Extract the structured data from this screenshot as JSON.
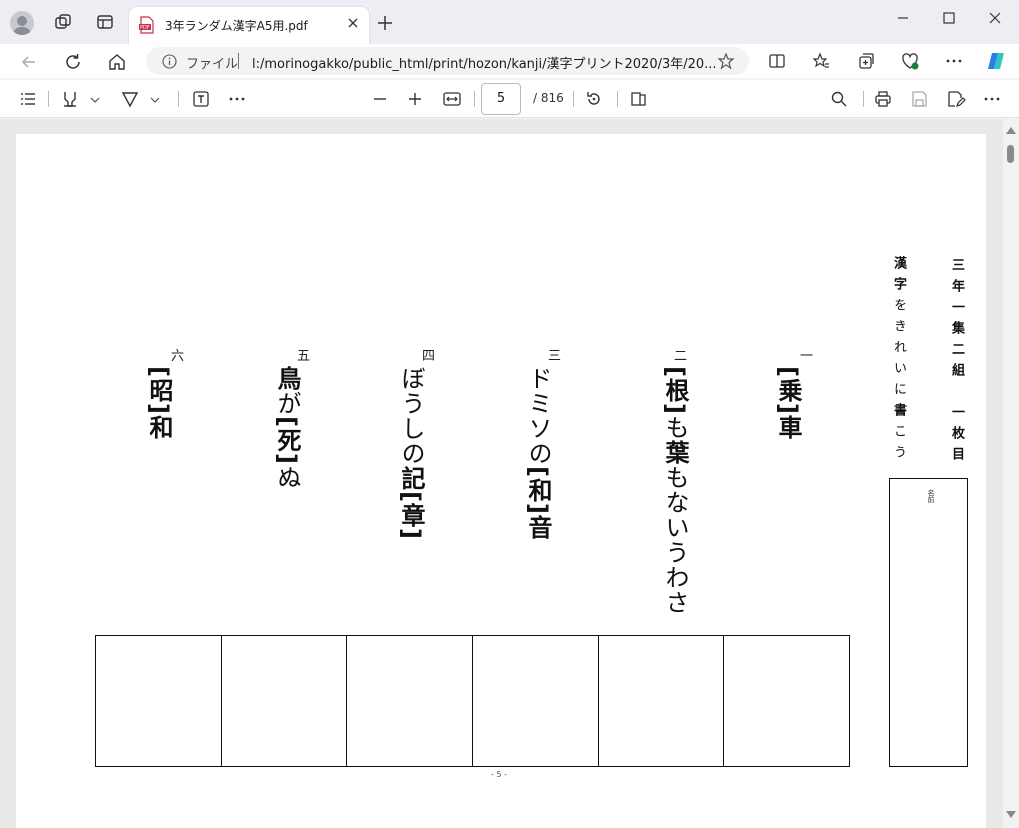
{
  "browser": {
    "tab_title": "3年ランダム漢字A5用.pdf",
    "url_prefix": "ファイル",
    "url": "l:/morinogakko/public_html/print/hozon/kanji/漢字プリント2020/3年/20..."
  },
  "pdf_toolbar": {
    "page_current": "5",
    "page_total": "/ 816"
  },
  "worksheet": {
    "title_vertical": "三年一集二組　一枚目",
    "instruction_vertical": [
      {
        "text": "漢",
        "bold": true
      },
      {
        "text": "字",
        "bold": true
      },
      {
        "text": "をきれいに",
        "bold": false
      },
      {
        "text": "書",
        "bold": true
      },
      {
        "text": "こう",
        "bold": false
      }
    ],
    "name_label": "名前",
    "questions": [
      {
        "num": "一",
        "parts": [
          {
            "t": "[乗]",
            "b": true
          },
          {
            "t": "車",
            "b": true
          }
        ]
      },
      {
        "num": "二",
        "parts": [
          {
            "t": "[根]",
            "b": true
          },
          {
            "t": "も",
            "b": false
          },
          {
            "t": "葉",
            "b": true
          },
          {
            "t": "もないうわさ",
            "b": false
          }
        ]
      },
      {
        "num": "三",
        "parts": [
          {
            "t": "ドミソの",
            "b": false
          },
          {
            "t": "[和]",
            "b": true
          },
          {
            "t": "音",
            "b": true
          }
        ]
      },
      {
        "num": "四",
        "parts": [
          {
            "t": "ぼうしの",
            "b": false
          },
          {
            "t": "記",
            "b": true
          },
          {
            "t": "[章]",
            "b": true
          }
        ]
      },
      {
        "num": "五",
        "parts": [
          {
            "t": "鳥",
            "b": true
          },
          {
            "t": "が",
            "b": false
          },
          {
            "t": "[死]",
            "b": true
          },
          {
            "t": "ぬ",
            "b": false
          }
        ]
      },
      {
        "num": "六",
        "parts": [
          {
            "t": "[昭]",
            "b": true
          },
          {
            "t": "和",
            "b": true
          }
        ]
      }
    ],
    "page_number": "- 5 -"
  }
}
